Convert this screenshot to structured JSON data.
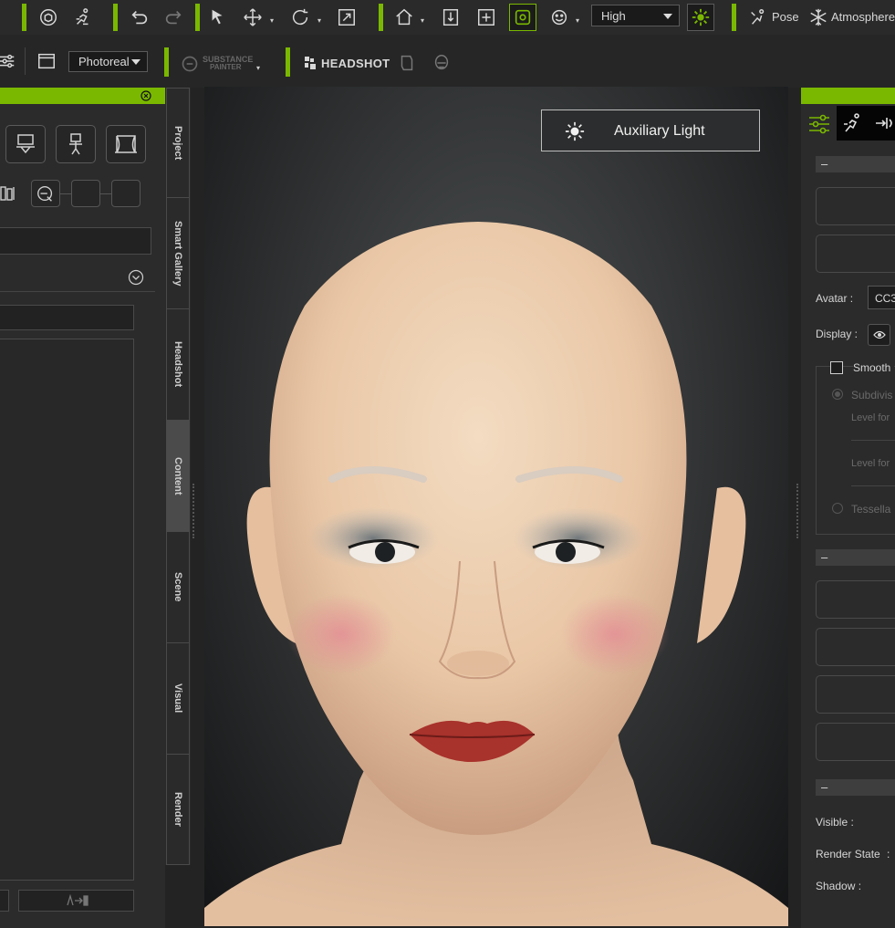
{
  "toolbar": {
    "quality_select": "High",
    "pose_label": "Pose",
    "atmosphere_label": "Atmosphere",
    "render_mode_select": "Photoreal",
    "substance_label": "SUBSTANCE",
    "substance_sub": "PAINTER",
    "headshot_label": "HEADSHOT"
  },
  "side_tabs": [
    "Project",
    "Smart Gallery",
    "Headshot",
    "Content",
    "Scene",
    "Visual",
    "Render"
  ],
  "viewport": {
    "light_label": "Auxiliary Light"
  },
  "right_panel": {
    "avatar_label": "Avatar :",
    "avatar_value": "CC3",
    "display_label": "Display :",
    "smooth_label": "Smooth",
    "subdivision_label": "Subdivis",
    "level_for_1": "Level for",
    "level_for_2": "Level for",
    "tessellation_label": "Tessella",
    "visible_label": "Visible :",
    "render_state_label": "Render State",
    "render_state_colon": ":",
    "shadow_label": "Shadow :"
  },
  "colors": {
    "accent": "#7ab800",
    "panel_bg": "#2b2b2b",
    "toolbar_bg": "#2a2a2a"
  }
}
